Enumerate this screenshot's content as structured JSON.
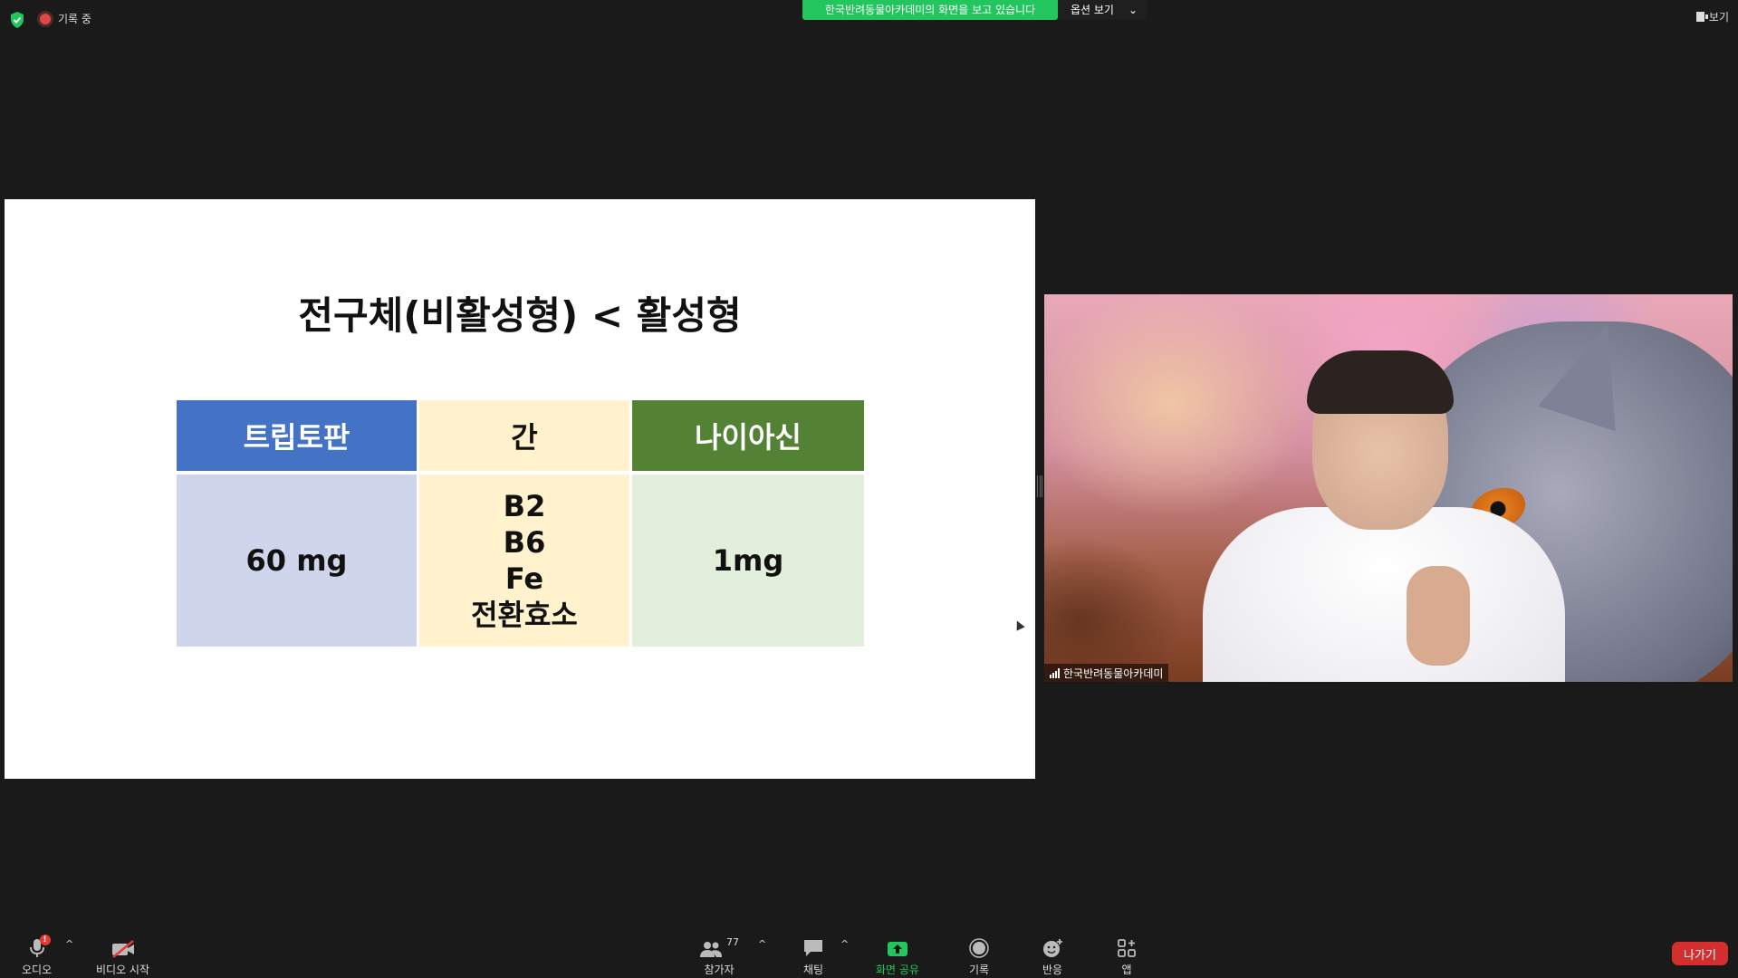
{
  "top_bar": {
    "recording_label": "기록 중",
    "viewing_banner": "한국반려동물아카데미의 화면을 보고 있습니다",
    "view_options_label": "옵션 보기",
    "view_button_label": "보기"
  },
  "slide": {
    "title": "전구체(비활성형) < 활성형",
    "table": {
      "headers": [
        "트립토판",
        "간",
        "나이아신"
      ],
      "row": {
        "col1": "60 mg",
        "col2_lines": [
          "B2",
          "B6",
          "Fe",
          "전환효소"
        ],
        "col3": "1mg"
      }
    }
  },
  "video": {
    "participant_name": "한국반려동물아카데미"
  },
  "toolbar": {
    "audio_label": "오디오",
    "video_label": "비디오 시작",
    "participants_label": "참가자",
    "participants_count": "77",
    "chat_label": "채팅",
    "share_label": "화면 공유",
    "record_label": "기록",
    "reactions_label": "반응",
    "apps_label": "앱",
    "leave_label": "나가기",
    "audio_badge": "!"
  },
  "colors": {
    "banner_green": "#22c55e",
    "header_blue": "#4472c4",
    "header_green": "#548235",
    "header_yellow": "#fff2cc",
    "leave_red": "#d32f2f"
  }
}
